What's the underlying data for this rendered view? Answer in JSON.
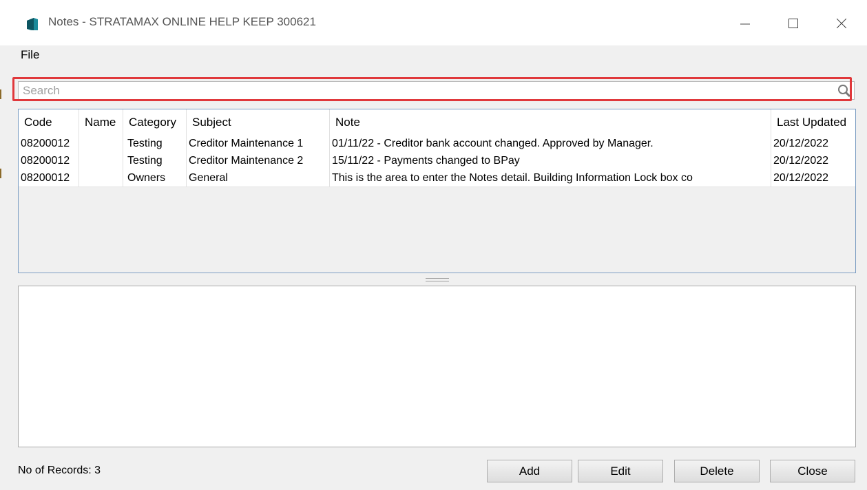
{
  "window": {
    "title": "Notes - STRATAMAX ONLINE HELP KEEP 300621",
    "minimize": "—",
    "maximize": "☐",
    "close": "✕",
    "icon": "stratamax-app-icon"
  },
  "menu": {
    "items": [
      "File"
    ]
  },
  "search": {
    "placeholder": "Search",
    "value": "",
    "icon": "search-icon"
  },
  "grid": {
    "columns": [
      "Code",
      "Name",
      "Category",
      "Subject",
      "Note",
      "Last Updated"
    ],
    "rows": [
      [
        "08200012",
        "",
        "Testing",
        "Creditor Maintenance 1",
        "01/11/22 - Creditor bank account changed. Approved by Manager.",
        "20/12/2022"
      ],
      [
        "08200012",
        "",
        "Testing",
        "Creditor Maintenance 2",
        "15/11/22 - Payments changed to BPay",
        "20/12/2022"
      ],
      [
        "08200012",
        "",
        "Owners",
        "General",
        "This is the area to enter the Notes detail. Building Information  Lock box co",
        "20/12/2022"
      ]
    ]
  },
  "detail": {
    "text": ""
  },
  "footer": {
    "records_label": "No of Records: 3",
    "buttons": {
      "add": "Add",
      "edit": "Edit",
      "delete": "Delete",
      "close": "Close"
    }
  },
  "colors": {
    "highlight": "#e0383b",
    "grid_border": "#7a9cc2",
    "app_icon": "#1a8a9a"
  }
}
